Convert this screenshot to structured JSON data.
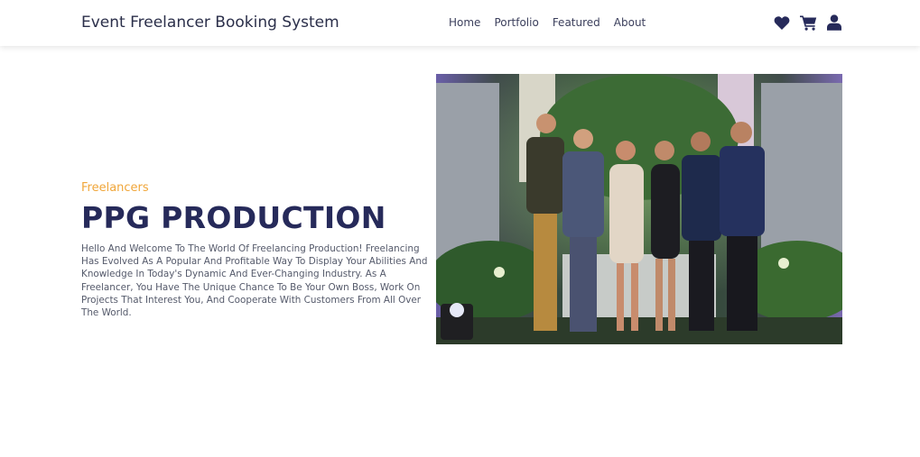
{
  "header": {
    "brand": "Event Freelancer Booking System",
    "nav": [
      "Home",
      "Portfolio",
      "Featured",
      "About"
    ],
    "icons": [
      "heart-icon",
      "cart-icon",
      "user-icon"
    ]
  },
  "hero": {
    "eyebrow": "Freelancers",
    "title": "PPG PRODUCTION",
    "description": "Hello And Welcome To The World Of Freelancing Production! Freelancing Has Evolved As A Popular And Profitable Way To Display Your Abilities And Knowledge In Today's Dynamic And Ever-Changing Industry. As A Freelancer, You Have The Unique Chance To Be Your Own Boss, Work On Projects That Interest You, And Cooperate With Customers From All Over The World."
  },
  "colors": {
    "brand_text": "#2b2f4a",
    "accent": "#f0a63a",
    "title": "#262a5a",
    "icon": "#262a5a"
  }
}
